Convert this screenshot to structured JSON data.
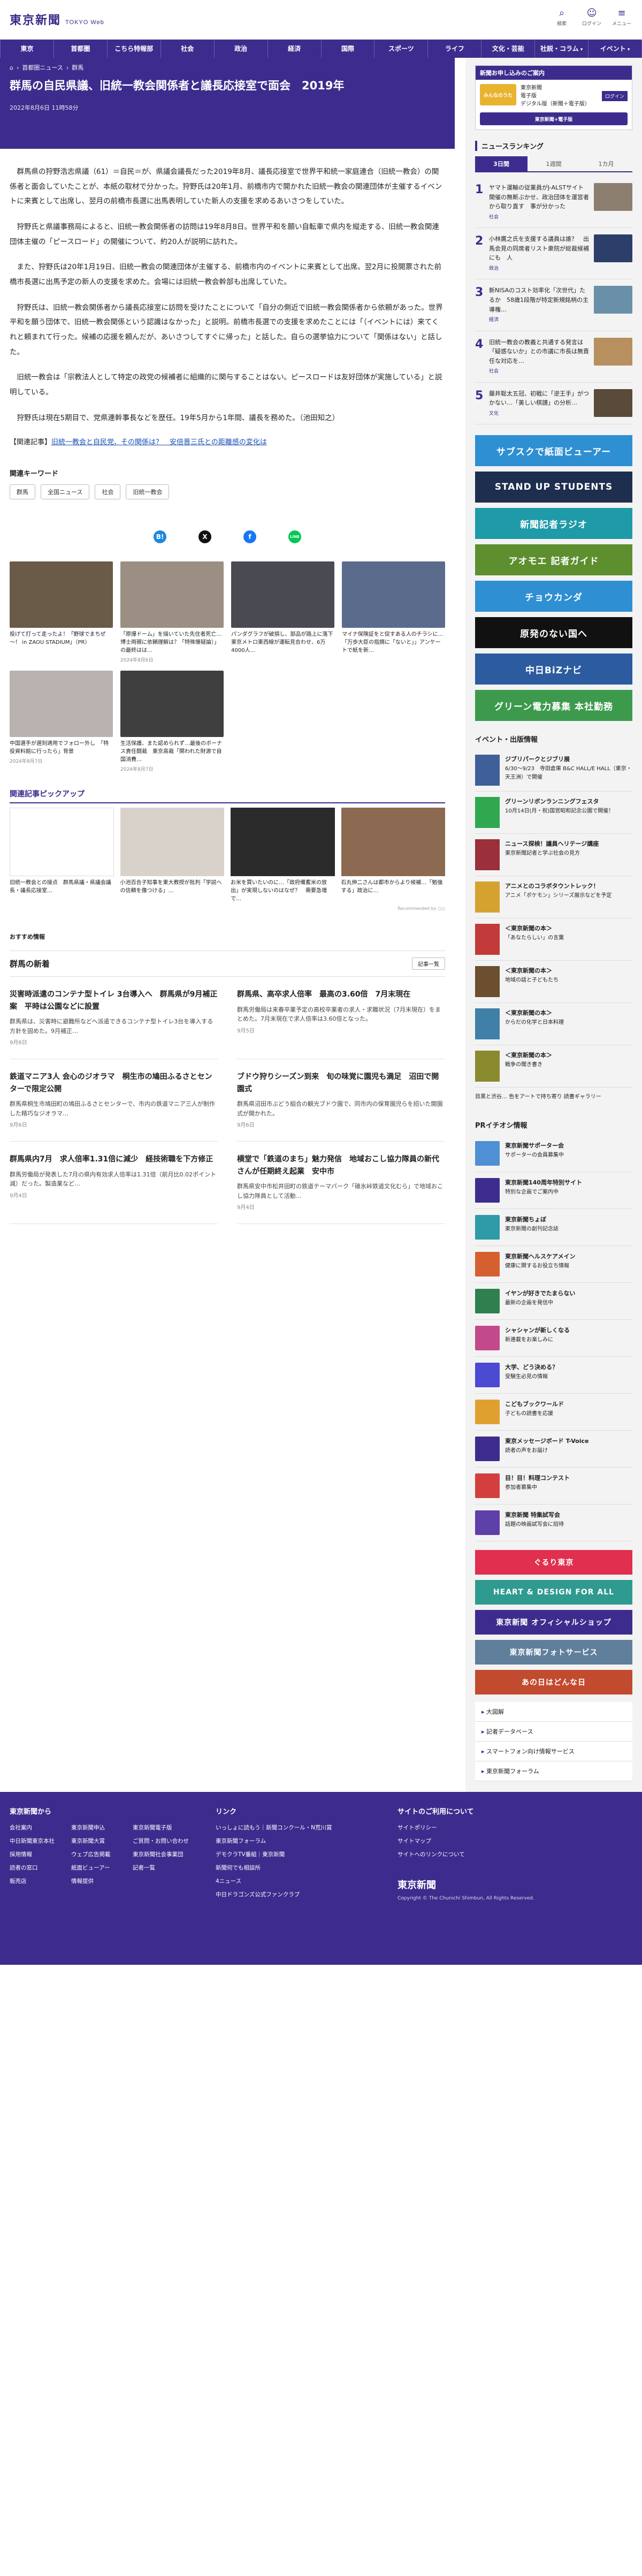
{
  "header": {
    "logo_jp": "東京新聞",
    "logo_en": "TOKYO Web",
    "icons": [
      {
        "name": "search-icon",
        "label": "検索"
      },
      {
        "name": "user-icon",
        "label": "ログイン"
      },
      {
        "name": "menu-icon",
        "label": "メニュー"
      }
    ]
  },
  "nav": [
    "東京",
    "首都圏",
    "こちら特報部",
    "社会",
    "政治",
    "経済",
    "国際",
    "スポーツ",
    "ライフ",
    "文化・芸能",
    "社説・コラム",
    "イベント"
  ],
  "article": {
    "breadcrumb": [
      "ホーム",
      "首都圏ニュース",
      "群馬"
    ],
    "title": "群馬の自民県議、旧統一教会関係者と議長応接室で面会　2019年",
    "date": "2022年8月6日 11時58分",
    "paragraphs": [
      "群馬県の狩野浩志県議（61）＝自民＝が、県議会議長だった2019年8月、議長応接室で世界平和統一家庭連合（旧統一教会）の関係者と面会していたことが、本紙の取材で分かった。狩野氏は20年1月、前橋市内で開かれた旧統一教会の関連団体が主催するイベントに来賓として出席し、翌月の前橋市長選に出馬表明していた新人の支援を求めるあいさつをしていた。",
      "狩野氏と県議事務局によると、旧統一教会関係者の訪問は19年8月8日。世界平和を願い自転車で県内を縦走する、旧統一教会関連団体主催の「ピースロード」の開催について、約20人が説明に訪れた。",
      "また、狩野氏は20年1月19日、旧統一教会の関連団体が主催する、前橋市内のイベントに来賓として出席。翌2月に投開票された前橋市長選に出馬予定の新人の支援を求めた。会場には旧統一教会幹部も出席していた。",
      "狩野氏は、旧統一教会関係者から議長応接室に訪問を受けたことについて「自分の側近で旧統一教会関係者から依頼があった。世界平和を願う団体で、旧統一教会関係という認識はなかった」と説明。前橋市長選での支援を求めたことには「（イベントには）来てくれと頼まれて行った。候補の応援を頼んだが、あいさつしてすぐに帰った」と話した。自らの選挙協力について「関係はない」と話した。",
      "旧統一教会は「宗教法人として特定の政党の候補者に組織的に関与することはない。ピースロードは友好団体が実施している」と説明している。",
      "狩野氏は現在5期目で、党県連幹事長などを歴任。19年5月から1年間、議長を務めた。（池田知之）"
    ],
    "related_prefix": "【関連記事】",
    "related_link": "旧統一教会と自民党、その関係は？　安倍晋三氏との距離感の変化は"
  },
  "keywords": {
    "label": "関連キーワード",
    "items": [
      "群馬",
      "全国ニュース",
      "社会",
      "旧統一教会"
    ]
  },
  "share": [
    "B!",
    "X",
    "f",
    "LINE"
  ],
  "photos": [
    {
      "caption": "投げて打って走ったよ！「野球でまちぜ～！ in ZAOU STADIUM」（PR）",
      "date": "",
      "color": "#6a5a48"
    },
    {
      "caption": "「原爆ドーム」を描いていた先住者死亡…博士両親に依頼理解は？「特殊懐疑論）」の最終はは…",
      "date": "2024年8月6日",
      "color": "#9a8f82"
    },
    {
      "caption": "パンダグラフが破損し、部品が路上に落下　東京メトロ東西線が運転見合わせ、6万4000人…",
      "date": "",
      "color": "#4a4b52"
    },
    {
      "caption": "マイナ保険証をと促すある人のチラシに…「万歩大臣の指摘に「ないと」」アンケートで紙を新…",
      "date": "",
      "color": "#5b6b8c"
    },
    {
      "caption": "中国選手が遅刻適用でフォロー外し　「特役資料館に行ったら」背景",
      "date": "2024年8月7日",
      "color": "#b9b2ae"
    },
    {
      "caption": "生活保護、また認められず…最後のボーナス責任闘裁　東京高裁「関われた財源で自国消費…",
      "date": "2024年8月7日",
      "color": "#3f3f3f"
    }
  ],
  "pickup": {
    "title": "関連記事ピックアップ",
    "items": [
      {
        "caption": "旧統一教会との接点　群馬県議・県議会議長・議長応接室…",
        "color": "#ffffff"
      },
      {
        "caption": "小池百合子知事を東大教授が批判「学説への信頼を傷つける」…",
        "color": "#d9d2ca"
      },
      {
        "caption": "お米を買いたいのに…「政府備蓄米の放出」が実現しないのはなぜ？　需要急増で…",
        "color": "#2b2b2b"
      },
      {
        "caption": "石丸伸二さんは都市からより候補…「勉強する」政治に…",
        "color": "#8c6a52"
      }
    ],
    "recommended_by": "Recommended by ○○"
  },
  "osusume": "おすすめ情報",
  "local_news": {
    "title": "群馬の新着",
    "more": "記事一覧",
    "items": [
      {
        "title": "災害時派遣のコンテナ型トイレ 3台導入へ　群馬県が9月補正案　平時は公園などに設置",
        "summary": "群馬県は、災害時に避難所などへ派遣できるコンテナ型トイレ3台を導入する方針を固めた。9月補正…",
        "date": "9月6日"
      },
      {
        "title": "群馬県、高卒求人倍率　最高の3.60倍　7月末現在",
        "summary": "群馬労働局は来春卒業予定の高校卒業者の求人・求職状況（7月末現在）をまとめた。7月末現在で求人倍率は3.60倍となった。",
        "date": "9月5日"
      },
      {
        "title": "鉄道マニア3人 会心のジオラマ　桐生市の鳩田ふるさとセンターで限定公開",
        "summary": "群馬県桐生市鳩田町の鳩田ふるさとセンターで、市内の鉄道マニア三人が制作した精巧なジオラマ…",
        "date": "9月6日"
      },
      {
        "title": "ブドウ狩りシーズン到来　旬の味覚に園児も満足　沼田で開園式",
        "summary": "群馬県沼田市ぶどう組合の観光ブドウ園で、同市内の保育園児らを招いた開園式が開かれた。",
        "date": "9月6日"
      },
      {
        "title": "群馬県内7月　求人倍率1.31倍に減少　経技術職を下方修正",
        "summary": "群馬労働局が発表した7月の県内有効求人倍率は1.31倍（前月比0.02ポイント減）だった。製造業など…",
        "date": "9月4日"
      },
      {
        "title": "横堂で「鉄道のまち」魅力発信　地域おこし協力隊員の新代さんが任期終え起業　安中市",
        "summary": "群馬県安中市松井田町の鉄道テーマパーク「碓氷峠鉄道文化むら」で地域おこし協力隊員として活動…",
        "date": "9月4日"
      }
    ]
  },
  "sidebar": {
    "promo": {
      "head": "新聞お申し込みのご案内",
      "lines": [
        "東京新聞",
        "電子版",
        "デジタル版（新聞＋電子版）"
      ],
      "login": "ログイン",
      "logo1": "みんなのうた",
      "logo2": "東京新聞+電子版"
    },
    "ranking": {
      "title": "ニュースランキング",
      "tabs": [
        "3日間",
        "1週間",
        "1カ月"
      ],
      "items": [
        {
          "no": "1",
          "text": "ヤマト運輸の従業員がJ-ALSTサイト　開催の無断ぶかせ、政治団体を運営者から取り直す　事が分かった",
          "cat": "社会"
        },
        {
          "no": "2",
          "text": "小林鷹之氏を支援する議員は誰？　出馬会見の同席者リスト衆院が総裁候補にも　人",
          "cat": "政治"
        },
        {
          "no": "3",
          "text": "新NISAのコスト効率化「次世代」たるか　58歳1段階が特定新規銘柄の主導権…",
          "cat": "経済"
        },
        {
          "no": "4",
          "text": "旧統一教会の教義と共通する発言は「疑惑ないか」との市議に市長は無責任な対応を…",
          "cat": "社会"
        },
        {
          "no": "5",
          "text": "藤井聡太五冠、初戦に「逆王手」がつかない…「美しい棋譜」の分析…",
          "cat": "文化"
        }
      ]
    },
    "banners": [
      {
        "label": "サブスクで紙面ビューアー",
        "color": "#2f8fd3"
      },
      {
        "label": "STAND UP STUDENTS",
        "color": "#1d2e4f"
      },
      {
        "label": "新聞記者ラジオ",
        "color": "#1f9aa8"
      },
      {
        "label": "アオモエ 記者ガイド",
        "color": "#5d8f2f"
      },
      {
        "label": "チョウカンダ",
        "color": "#2f8fd3"
      },
      {
        "label": "原発のない国へ",
        "color": "#111111"
      },
      {
        "label": "中日BiZナビ",
        "color": "#2c5c9f"
      },
      {
        "label": "グリーン電力募集 本社勤務",
        "color": "#3d9a4d"
      }
    ],
    "events": {
      "title": "イベント・出版情報",
      "items": [
        {
          "title": "ジブリパークとジブリ展",
          "text": "6/30〜9/23　寺田倉庫 B&C HALL/E HALL（東京・天王洲）で開催",
          "color": "#3f5f9a"
        },
        {
          "title": "グリーンリボンランニングフェスタ",
          "text": "10月14日(月・祝)国営昭和記念公園で開催！",
          "color": "#2fa84f"
        },
        {
          "title": "ニュース探検！議員ヘリテージ講座",
          "text": "東京新聞記者と学ぶ社会の見方",
          "color": "#9b2f3a"
        },
        {
          "title": "アニメとのコラボタウントレック！",
          "text": "アニメ「ポケモン」シリーズ展示などを予定",
          "color": "#d6a22f"
        },
        {
          "title": "＜東京新聞の本＞",
          "text": "「あなたらしい」の言葉",
          "color": "#c23a3a"
        },
        {
          "title": "＜東京新聞の本＞",
          "text": "地域の話と子どもたち",
          "color": "#6b4f2f"
        },
        {
          "title": "＜東京新聞の本＞",
          "text": "からだの化学と日本料理",
          "color": "#3f7fa8"
        },
        {
          "title": "＜東京新聞の本＞",
          "text": "戦争の聞き書き",
          "color": "#8a8a2f"
        }
      ]
    },
    "gallery_note": "目黒と渋谷… 色をアートで持ち寄り 読書ギャラリー",
    "pr": {
      "title": "PRイチオシ情報",
      "items": [
        {
          "title": "東京新聞サポーター会",
          "text": "サポーターの会員募集中",
          "color": "#4f8fd3"
        },
        {
          "title": "東京新聞140周年特別サイト",
          "text": "特別な企画でご案内中",
          "color": "#3d2c8d"
        },
        {
          "title": "東京新聞ちょぼ",
          "text": "東京新聞の創刊記念誌",
          "color": "#2f9aa8"
        },
        {
          "title": "東京新聞ヘルスケアメイン",
          "text": "健康に関するお役立ち情報",
          "color": "#d65f2f"
        },
        {
          "title": "イヤンが好きでたまらない",
          "text": "最新の企画を発信中",
          "color": "#2f7f4f"
        },
        {
          "title": "シャシャンが新しくなる",
          "text": "新連載をお楽しみに",
          "color": "#c24a8a"
        },
        {
          "title": "大学、どう決める？",
          "text": "受験生必見の情報",
          "color": "#4a4ad3"
        },
        {
          "title": "こどもブックワールド",
          "text": "子どもの読書を応援",
          "color": "#e0a02f"
        },
        {
          "title": "東京メッセージボード T-Voice",
          "text": "読者の声をお届け",
          "color": "#3d2c8d"
        },
        {
          "title": "目！目！料理コンテスト",
          "text": "参加者募集中",
          "color": "#d33f3f"
        },
        {
          "title": "東京新聞 特集試写会",
          "text": "話題の映画試写会に招待",
          "color": "#5f3fa8"
        }
      ]
    },
    "bottom_banners": [
      {
        "label": "ぐるり東京",
        "color": "#e02f4f"
      },
      {
        "label": "HEART & DESIGN FOR ALL",
        "color": "#2f9a8f"
      },
      {
        "label": "東京新聞 オフィシャルショップ",
        "color": "#3d2c8d"
      },
      {
        "label": "東京新聞フォトサービス",
        "color": "#5f7f9a"
      },
      {
        "label": "あの日はどんな日",
        "color": "#c24a2f"
      }
    ],
    "links": [
      "大図解",
      "記者データベース",
      "スマートフォン向け情報サービス",
      "東京新聞フォーラム"
    ]
  },
  "footer": {
    "cols": [
      {
        "title": "東京新聞から",
        "items": [
          "会社案内",
          "東京新聞申込",
          "東京新聞電子版",
          "中日新聞東京本社",
          "東京新聞大賞",
          "ご質問・お問い合わせ",
          "採用情報",
          "ウェブ広告掲載",
          "東京新聞社会事業団",
          "読者の窓口",
          "紙面ビューアー",
          "記者一覧",
          "販売店",
          "情報提供"
        ]
      },
      {
        "title": "リンク",
        "items": [
          "いっしょに読もう｜新聞コンクール・N荒川賞",
          "東京新聞フォーラム",
          "デモクラTV番組｜東京新聞",
          "新聞何でも相談所",
          "4ニュース",
          "中日ドラゴンズ公式ファンクラブ"
        ]
      },
      {
        "title": "サイトのご利用について",
        "items": [
          "サイトポリシー",
          "サイトマップ",
          "サイトへのリンクについて"
        ]
      }
    ],
    "logo": "東京新聞",
    "copyright": "Copyright © The Chunichi Shimbun, All Rights Reserved."
  }
}
